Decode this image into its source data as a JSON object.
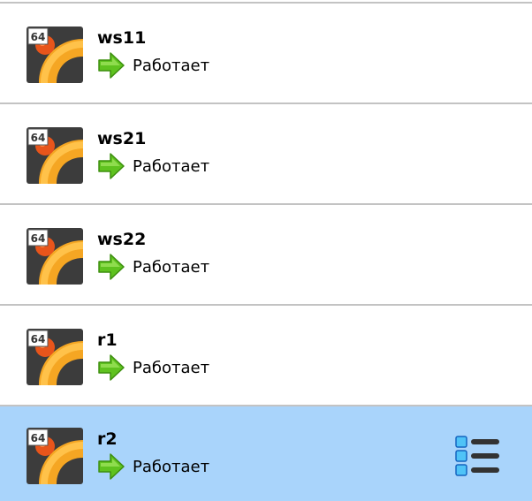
{
  "vms": [
    {
      "name": "ws11",
      "state": "Работает",
      "os_icon": "ubuntu-64-icon",
      "state_icon": "running-arrow-icon",
      "arch_badge": "64",
      "selected": false
    },
    {
      "name": "ws21",
      "state": "Работает",
      "os_icon": "ubuntu-64-icon",
      "state_icon": "running-arrow-icon",
      "arch_badge": "64",
      "selected": false
    },
    {
      "name": "ws22",
      "state": "Работает",
      "os_icon": "ubuntu-64-icon",
      "state_icon": "running-arrow-icon",
      "arch_badge": "64",
      "selected": false
    },
    {
      "name": "r1",
      "state": "Работает",
      "os_icon": "ubuntu-64-icon",
      "state_icon": "running-arrow-icon",
      "arch_badge": "64",
      "selected": false
    },
    {
      "name": "r2",
      "state": "Работает",
      "os_icon": "ubuntu-64-icon",
      "state_icon": "running-arrow-icon",
      "arch_badge": "64",
      "selected": true,
      "action_icon": "details-menu-icon"
    }
  ],
  "colors": {
    "selected_bg": "#a9d4fb",
    "separator": "#c3c3c3",
    "arrow_green": "#5fc21f"
  }
}
